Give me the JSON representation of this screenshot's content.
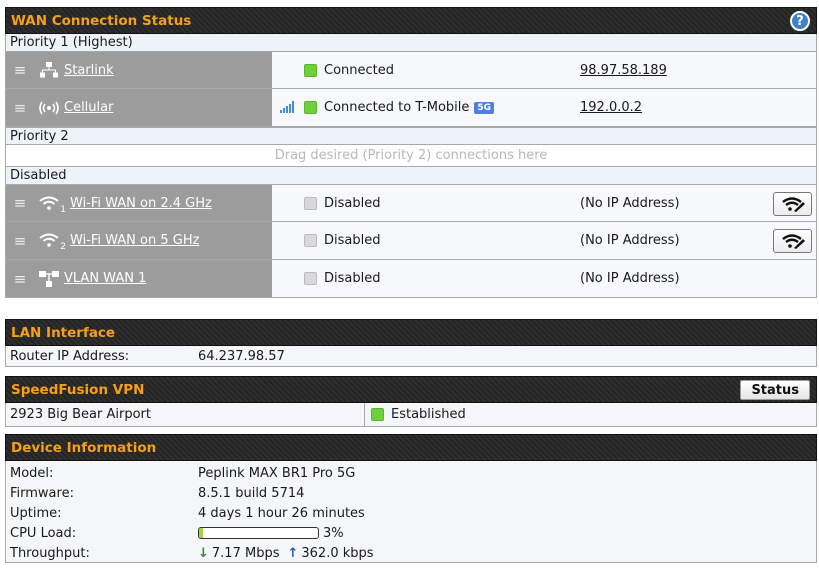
{
  "wan": {
    "title": "WAN Connection Status",
    "help": "?",
    "priority1_label": "Priority 1 (Highest)",
    "priority2_label": "Priority 2",
    "drop_text": "Drag desired (Priority 2) connections here",
    "disabled_label": "Disabled",
    "connections": [
      {
        "name": "Starlink",
        "status": "Connected",
        "ip": "98.97.58.189",
        "icon": "ethernet-icon"
      },
      {
        "name": "Cellular",
        "status": "Connected to T-Mobile",
        "badge": "5G",
        "ip": "192.0.0.2",
        "icon": "cellular-icon"
      },
      {
        "name": "Wi-Fi WAN on 2.4 GHz",
        "num": "1",
        "status": "Disabled",
        "ip": "(No IP Address)",
        "icon": "wifi-icon"
      },
      {
        "name": "Wi-Fi WAN on 5 GHz",
        "num": "2",
        "status": "Disabled",
        "ip": "(No IP Address)",
        "icon": "wifi-icon"
      },
      {
        "name": "VLAN WAN 1",
        "status": "Disabled",
        "ip": "(No IP Address)",
        "icon": "vlan-icon"
      }
    ]
  },
  "lan": {
    "title": "LAN Interface",
    "router_ip_label": "Router IP Address:",
    "router_ip": "64.237.98.57"
  },
  "speedfusion": {
    "title": "SpeedFusion VPN",
    "status_button": "Status",
    "peer": "2923 Big Bear Airport",
    "state": "Established"
  },
  "device": {
    "title": "Device Information",
    "model_label": "Model:",
    "model": "Peplink MAX BR1 Pro 5G",
    "firmware_label": "Firmware:",
    "firmware": "8.5.1 build 5714",
    "uptime_label": "Uptime:",
    "uptime": "4 days 1 hour 26 minutes",
    "cpu_label": "CPU Load:",
    "cpu_percent": 3,
    "cpu_text": "3%",
    "throughput_label": "Throughput:",
    "down": "7.17 Mbps",
    "up": "362.0 kbps"
  },
  "colors": {
    "accent": "#f6a019",
    "connected": "#6cd13a",
    "disabled": "#d9d9d9",
    "signal": "#3e8ee0"
  }
}
